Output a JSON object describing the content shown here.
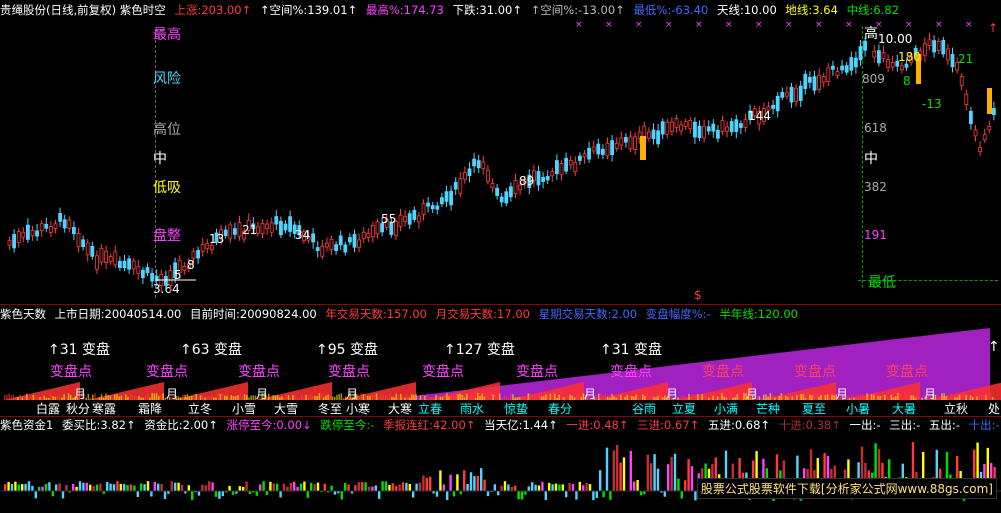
{
  "colors": {
    "bg": "#000000",
    "red": "#ff3b3b",
    "cyan": "#4fd4ff",
    "magenta": "#ff40ff",
    "yellow": "#ffff00",
    "green": "#00e000",
    "purple": "#a020c0",
    "orange": "#ff9000"
  },
  "top_header": [
    {
      "text": "贵绳股份(日线,前复权) 紫色时空",
      "color": "#ffffff"
    },
    {
      "text": "上涨:203.00↑",
      "color": "#ff3b3b"
    },
    {
      "text": "↑空间%:139.01↑",
      "color": "#ffffff"
    },
    {
      "text": "最高%:174.73",
      "color": "#ff40ff"
    },
    {
      "text": "下跌:31.00↑",
      "color": "#ffffff"
    },
    {
      "text": "↑空间%:-13.00↑",
      "color": "#bbbbbb"
    },
    {
      "text": "最低%:-63.40",
      "color": "#4466ff"
    },
    {
      "text": "天线:10.00",
      "color": "#ffffff"
    },
    {
      "text": "地线:3.64",
      "color": "#ffff00"
    },
    {
      "text": "中线:6.82",
      "color": "#00e000"
    }
  ],
  "main_chart": {
    "left_labels": [
      {
        "text": "最高",
        "color": "#ff40ff"
      },
      {
        "text": "风险",
        "color": "#4fd4ff"
      },
      {
        "text": "高位",
        "color": "#aaaaaa"
      },
      {
        "text": "中",
        "color": "#ffffff"
      },
      {
        "text": "低吸",
        "color": "#ffff00"
      },
      {
        "text": "盘整",
        "color": "#ff40ff"
      }
    ],
    "right_labels": [
      {
        "text": "高",
        "color": "#ffffff"
      },
      {
        "text": "10.00",
        "color": "#ffffff"
      },
      {
        "text": "809",
        "color": "#aaaaaa"
      },
      {
        "text": "618",
        "color": "#aaaaaa"
      },
      {
        "text": "中",
        "color": "#ffffff"
      },
      {
        "text": "382",
        "color": "#aaaaaa"
      },
      {
        "text": "191",
        "color": "#ff40ff"
      },
      {
        "text": "最低",
        "color": "#00e000"
      }
    ],
    "low_value": "3.64",
    "right_edge_tag": "↑",
    "cycle_numbers": [
      {
        "text": "5"
      },
      {
        "text": "8"
      },
      {
        "text": "13"
      },
      {
        "text": "21"
      },
      {
        "text": "34"
      },
      {
        "text": "55"
      },
      {
        "text": "89"
      },
      {
        "text": "144"
      }
    ],
    "zoom_numbers": [
      {
        "text": "180"
      },
      {
        "text": "8"
      },
      {
        "text": "21"
      },
      {
        "text": "-13"
      }
    ],
    "dollar_mark": "$"
  },
  "purple_days": {
    "header": [
      {
        "text": "紫色天数",
        "color": "#ffffff"
      },
      {
        "text": "上市日期:20040514.00",
        "color": "#ffffff"
      },
      {
        "text": "目前时间:20090824.00",
        "color": "#ffffff"
      },
      {
        "text": "年交易天数:157.00",
        "color": "#ff3b3b"
      },
      {
        "text": "月交易天数:17.00",
        "color": "#ff3b3b"
      },
      {
        "text": "星期交易天数:2.00",
        "color": "#4466ff"
      },
      {
        "text": "变盘幅度%:-",
        "color": "#4466ff"
      },
      {
        "text": "半年线:120.00",
        "color": "#00e000"
      }
    ],
    "change_labels": [
      {
        "text": "↑31 变盘"
      },
      {
        "text": "↑63 变盘"
      },
      {
        "text": "↑95 变盘"
      },
      {
        "text": "↑127 变盘"
      },
      {
        "text": "↑31 变盘"
      },
      {
        "text": "↑"
      }
    ],
    "change_points": [
      {
        "text": "变盘点"
      },
      {
        "text": "变盘点"
      },
      {
        "text": "变盘点"
      },
      {
        "text": "变盘点"
      },
      {
        "text": "变盘点"
      },
      {
        "text": "变盘点"
      },
      {
        "text": "变盘点"
      },
      {
        "text": "变盘点"
      },
      {
        "text": "变盘点"
      },
      {
        "text": "变盘点"
      }
    ],
    "month_label": "月",
    "terms": [
      {
        "text": "白露"
      },
      {
        "text": "秋分"
      },
      {
        "text": "寒露"
      },
      {
        "text": "霜降"
      },
      {
        "text": "立冬"
      },
      {
        "text": "小雪"
      },
      {
        "text": "大雪"
      },
      {
        "text": "冬至"
      },
      {
        "text": "小寒"
      },
      {
        "text": "大寒"
      },
      {
        "text": "立春"
      },
      {
        "text": "雨水"
      },
      {
        "text": "惊蛰"
      },
      {
        "text": "春分"
      },
      {
        "text": "谷雨"
      },
      {
        "text": "立夏"
      },
      {
        "text": "小满"
      },
      {
        "text": "芒种"
      },
      {
        "text": "夏至"
      },
      {
        "text": "小暑"
      },
      {
        "text": "大暑"
      },
      {
        "text": "立秋"
      },
      {
        "text": "处"
      }
    ]
  },
  "purple_fund": {
    "header": [
      {
        "text": "紫色资金1",
        "color": "#ffffff"
      },
      {
        "text": "委买比:3.82↑",
        "color": "#ffffff"
      },
      {
        "text": "资金比:2.00↑",
        "color": "#ffffff"
      },
      {
        "text": "涨停至今:0.00↓",
        "color": "#ff40ff"
      },
      {
        "text": "跌停至今:-",
        "color": "#00e000"
      },
      {
        "text": "季报连红:42.00↑",
        "color": "#ff3b3b"
      },
      {
        "text": "当天亿:1.44↑",
        "color": "#ffffff"
      },
      {
        "text": "一进:0.48↑",
        "color": "#ff3b3b"
      },
      {
        "text": "三进:0.67↑",
        "color": "#ff3b3b"
      },
      {
        "text": "五进:0.68↑",
        "color": "#ffffff"
      },
      {
        "text": "十进:0.38↑",
        "color": "#aa3030"
      },
      {
        "text": "一出:-",
        "color": "#ffffff"
      },
      {
        "text": "三出:-",
        "color": "#ffffff"
      },
      {
        "text": "五出:-",
        "color": "#ffffff"
      },
      {
        "text": "十出:-",
        "color": "#4466ff"
      }
    ],
    "watermark": "股票公式股票软件下载[分析家公式网www.88gs.com]"
  }
}
